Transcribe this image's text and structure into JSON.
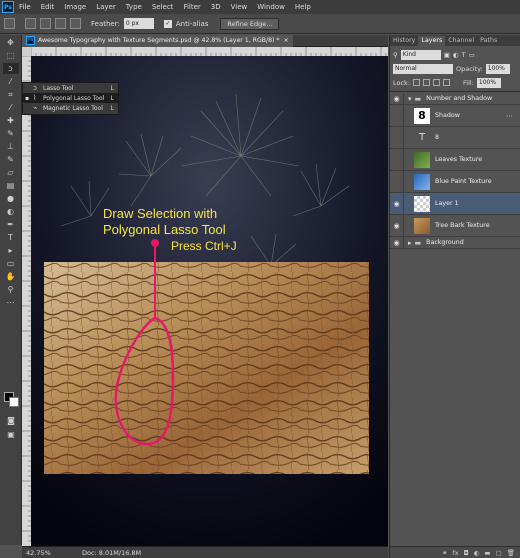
{
  "menubar": {
    "logo": "Ps",
    "items": [
      "File",
      "Edit",
      "Image",
      "Layer",
      "Type",
      "Select",
      "Filter",
      "3D",
      "View",
      "Window",
      "Help"
    ]
  },
  "options": {
    "feather_label": "Feather:",
    "feather_value": "0 px",
    "antialias_label": "Anti-alias",
    "refine_edge": "Refine Edge..."
  },
  "flyout": {
    "items": [
      {
        "label": "Lasso Tool",
        "key": "L",
        "icon": "lasso-icon"
      },
      {
        "label": "Polygonal Lasso Tool",
        "key": "L",
        "icon": "polygonal-lasso-icon"
      },
      {
        "label": "Magnetic Lasso Tool",
        "key": "L",
        "icon": "magnetic-lasso-icon"
      }
    ]
  },
  "document": {
    "tab_title": "Awesome Typography with Texture Segments.psd @ 42.8% (Layer 1, RGB/8) *",
    "canvas_text_line1": "Draw Selection with",
    "canvas_text_line2": "Polygonal Lasso Tool",
    "canvas_text_line3": "Press Ctrl+J",
    "status_zoom": "42.75%",
    "status_doc": "Doc: 8.01M/16.8M"
  },
  "panel": {
    "tabs": [
      "History",
      "Layers",
      "Channel",
      "Paths"
    ],
    "active_tab": "Layers",
    "kind_label": "Kind",
    "blend_mode": "Normal",
    "opacity_label": "Opacity:",
    "opacity_value": "100%",
    "lock_label": "Lock:",
    "fill_label": "Fill:",
    "fill_value": "100%",
    "layers": [
      {
        "name": "Number and Shadow",
        "type": "group"
      },
      {
        "name": "Shadow",
        "type": "layer"
      },
      {
        "name": "8",
        "type": "text"
      },
      {
        "name": "Leaves Texture",
        "type": "layer"
      },
      {
        "name": "Blue Paint Texture",
        "type": "layer"
      },
      {
        "name": "Layer 1",
        "type": "layer",
        "selected": true
      },
      {
        "name": "Tree Bark Texture",
        "type": "layer"
      },
      {
        "name": "Background",
        "type": "group"
      }
    ]
  },
  "colors": {
    "accent_text": "#f5e642",
    "arrow": "#e8176a",
    "selected_layer": "#4a5c75"
  }
}
